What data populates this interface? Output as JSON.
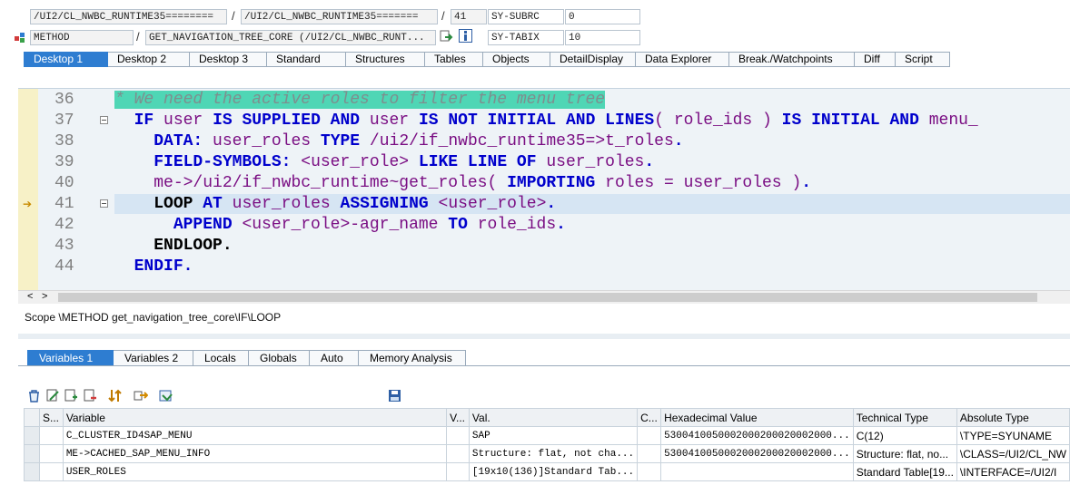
{
  "top_fields": {
    "program": "/UI2/CL_NWBC_RUNTIME35========",
    "include": "/UI2/CL_NWBC_RUNTIME35=======",
    "line": "41",
    "var1_name": "SY-SUBRC",
    "var1_value": "0",
    "event_type": "METHOD",
    "event_name": "GET_NAVIGATION_TREE_CORE (/UI2/CL_NWBC_RUNT...",
    "var2_name": "SY-TABIX",
    "var2_value": "10",
    "sep1": "/",
    "sep2": "/",
    "sep3": "/"
  },
  "desktop_tabs": [
    "Desktop 1",
    "Desktop 2",
    "Desktop 3",
    "Standard",
    "Structures",
    "Tables",
    "Objects",
    "DetailDisplay",
    "Data Explorer",
    "Break./Watchpoints",
    "Diff",
    "Script"
  ],
  "editor": {
    "line_numbers": [
      "36",
      "37",
      "38",
      "39",
      "40",
      "41",
      "42",
      "43",
      "44"
    ],
    "current_line": "41"
  },
  "scope_text": "Scope \\METHOD get_navigation_tree_core\\IF\\LOOP",
  "variable_tabs": [
    "Variables 1",
    "Variables 2",
    "Locals",
    "Globals",
    "Auto",
    "Memory Analysis"
  ],
  "toolbar_icons": [
    "delete-icon",
    "edit-icon",
    "new-icon",
    "remove-row-icon",
    "sort-icon",
    "transfer-icon",
    "settings-icon",
    "save-icon"
  ],
  "table": {
    "headers": [
      "S...",
      "Variable",
      "V...",
      "Val.",
      "C...",
      "Hexadecimal Value",
      "Technical Type",
      "Absolute Type"
    ],
    "rows": [
      {
        "variable": "C_CLUSTER_ID4SAP_MENU",
        "value": "SAP",
        "hex": "5300410050002000200020002000...",
        "tech": "C(12)",
        "abs": "\\TYPE=SYUNAME"
      },
      {
        "variable": "ME->CACHED_SAP_MENU_INFO",
        "value": "Structure: flat, not cha...",
        "hex": "5300410050002000200020002000...",
        "tech": "Structure: flat, no...",
        "abs": "\\CLASS=/UI2/CL_NW"
      },
      {
        "variable": "USER_ROLES",
        "value": "[19x10(136)]Standard Tab...",
        "hex": "",
        "tech": "Standard Table[19...",
        "abs": "\\INTERFACE=/UI2/I"
      }
    ]
  }
}
